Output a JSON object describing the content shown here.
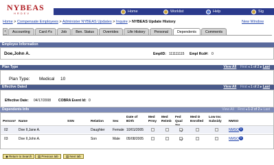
{
  "header": {
    "logo": "NYBEAS",
    "logo_sub": "HRDEV",
    "nav": [
      {
        "label": "Home",
        "icon": "home-icon"
      },
      {
        "label": "Worklist",
        "icon": "worklist-icon"
      },
      {
        "label": "Help",
        "icon": "help-icon"
      },
      {
        "label": "Sig",
        "icon": "signout-icon"
      }
    ]
  },
  "breadcrumb": {
    "items": [
      "Home",
      "Compensate Employees",
      "Administer NYBEAS Updates",
      "Inquire"
    ],
    "separator": ">",
    "current": "NYBEAS Update History"
  },
  "new_window": "New Window",
  "tabs": [
    "Accounting",
    "Card #'s",
    "Job",
    "Ben. Status",
    "Overrides",
    "Life History",
    "Personal",
    "Dependents",
    "Comments"
  ],
  "active_tab": "Dependents",
  "employee": {
    "section_title": "Employee Information",
    "name": "Doe,John A.",
    "emplid_label": "EmplID:",
    "emplid": "111111115",
    "empl_rcd_label": "Empl Rcd#:",
    "empl_rcd": "0"
  },
  "plan": {
    "section_title": "Plan Type",
    "view_all": "View All",
    "nav_first": "First",
    "nav_range": "1 of 2",
    "nav_last": "Last",
    "label": "Plan Type:",
    "type": "Medical",
    "code": "10"
  },
  "effective": {
    "section_title": "Effective Dated",
    "view_all": "View All",
    "nav_first": "First",
    "nav_range": "1 of 2",
    "nav_last": "Last",
    "date_label": "Effective Date:",
    "date": "04/17/2008",
    "cobra_label": "COBRA Event Id:",
    "cobra": "0"
  },
  "dependents": {
    "section_title": "Dependents Info",
    "view_all": "View All",
    "nav_first": "First",
    "nav_range": "1-2 of 2",
    "nav_last": "Last",
    "columns": [
      "Person#",
      "Name",
      "SSN",
      "Relation",
      "Sex",
      "Date of Birth",
      "Med Prmy",
      "Med Reimb",
      "Fed Qual Sw",
      "Med D Enrolled",
      "Low Inc Subsidy",
      "NMSO"
    ],
    "rows": [
      {
        "person": "02",
        "name": "Doe II,Jane A.",
        "ssn": "",
        "relation": "Daughter",
        "sex": "Female",
        "dob": "10/01/2005",
        "med_prmy": false,
        "med_reimb": false,
        "fed_qual": true,
        "med_d": false,
        "low_inc": false,
        "nmso": "NMSO"
      },
      {
        "person": "03",
        "name": "Doe II,John A.",
        "ssn": "",
        "relation": "Son",
        "sex": "Male",
        "dob": "05/08/2005",
        "med_prmy": false,
        "med_reimb": false,
        "fed_qual": true,
        "med_d": false,
        "low_inc": false,
        "nmso": "NMSO"
      }
    ]
  },
  "buttons": {
    "return": "Return to Search",
    "prev": "Previous tab",
    "next": "Next tab"
  }
}
